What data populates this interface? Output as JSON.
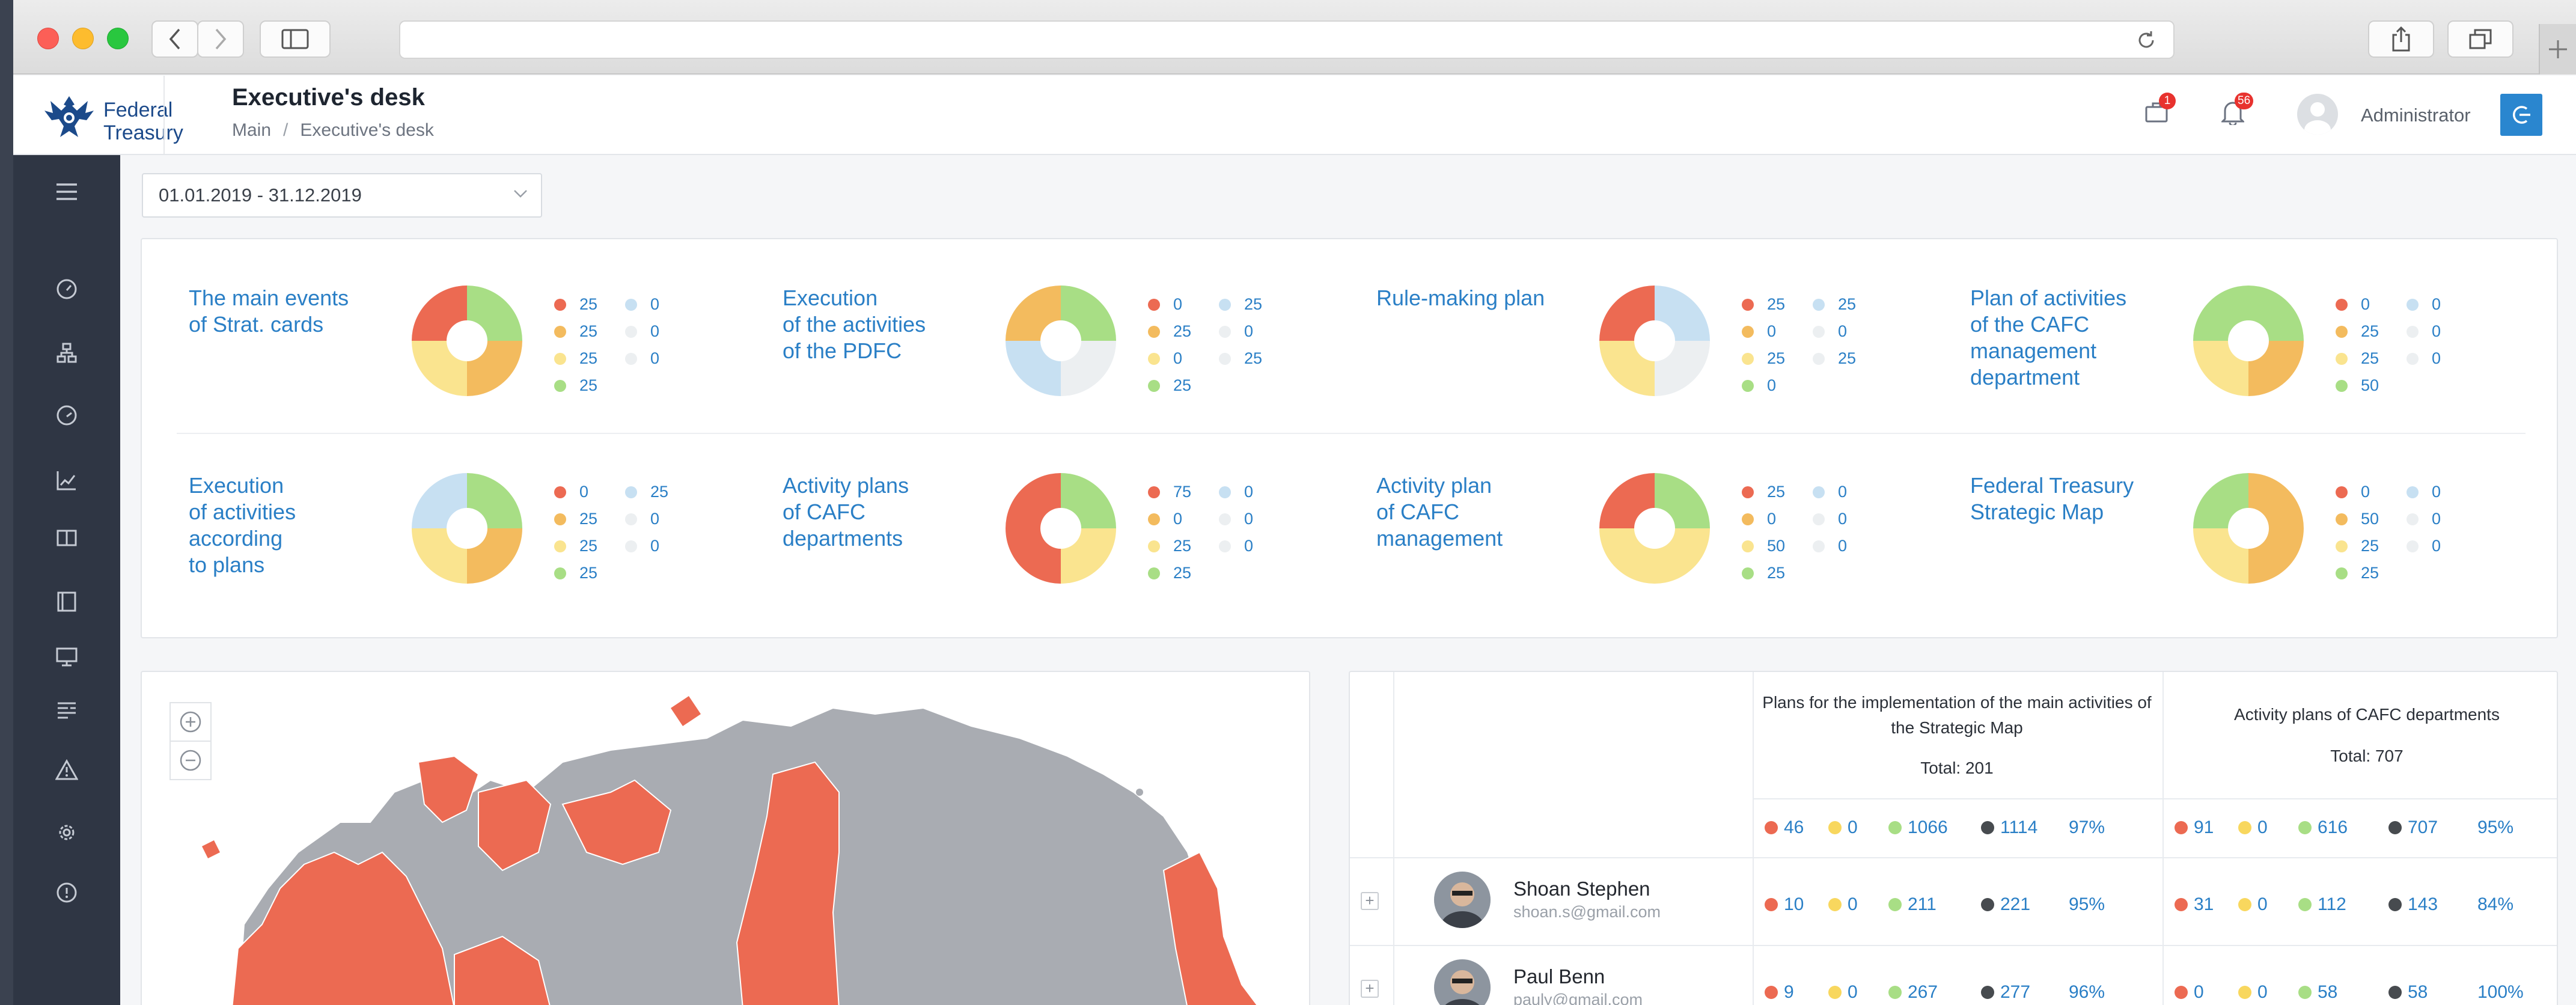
{
  "colors": {
    "red": "#ec6a52",
    "orange": "#f3bb5e",
    "yellow": "#fae48f",
    "green": "#a8de85",
    "blue": "#c7e0f2",
    "gray": "#eceff1",
    "dark": "#474b4f",
    "accent": "#2a7fc6"
  },
  "browser": {
    "nav_back_icon": "chevron-left-icon",
    "nav_forward_icon": "chevron-right-icon"
  },
  "header": {
    "logo_text": "Federal\nTreasury",
    "title": "Executive's desk",
    "breadcrumb": [
      "Main",
      "Executive's desk"
    ],
    "tasks_badge": "1",
    "notifications_badge": "56",
    "user_name": "Administrator"
  },
  "filter": {
    "date_range": "01.01.2019 - 31.12.2019"
  },
  "cards": [
    {
      "title": "The main events\nof Strat. cards",
      "values": {
        "red": "25",
        "orange": "25",
        "yellow": "25",
        "green": "25",
        "blue": "0",
        "gray1": "0",
        "gray2": "0"
      },
      "segments": [
        {
          "c": "green",
          "v": 25
        },
        {
          "c": "orange",
          "v": 25
        },
        {
          "c": "yellow",
          "v": 25
        },
        {
          "c": "red",
          "v": 25
        }
      ]
    },
    {
      "title": "Execution\nof the activities\nof the PDFC",
      "values": {
        "red": "0",
        "orange": "25",
        "yellow": "0",
        "green": "25",
        "blue": "25",
        "gray1": "0",
        "gray2": "25"
      },
      "segments": [
        {
          "c": "green",
          "v": 25
        },
        {
          "c": "gray",
          "v": 25
        },
        {
          "c": "blue",
          "v": 25
        },
        {
          "c": "orange",
          "v": 25
        }
      ]
    },
    {
      "title": "Rule-making plan",
      "values": {
        "red": "25",
        "orange": "0",
        "yellow": "25",
        "green": "0",
        "blue": "25",
        "gray1": "0",
        "gray2": "25"
      },
      "segments": [
        {
          "c": "blue",
          "v": 25
        },
        {
          "c": "gray",
          "v": 25
        },
        {
          "c": "yellow",
          "v": 25
        },
        {
          "c": "red",
          "v": 25
        }
      ]
    },
    {
      "title": "Plan of activities\nof the CAFC\nmanagement\ndepartment",
      "values": {
        "red": "0",
        "orange": "25",
        "yellow": "25",
        "green": "50",
        "blue": "0",
        "gray1": "0",
        "gray2": "0"
      },
      "segments": [
        {
          "c": "green",
          "v": 25
        },
        {
          "c": "orange",
          "v": 25
        },
        {
          "c": "yellow",
          "v": 25
        },
        {
          "c": "green",
          "v": 25
        }
      ]
    },
    {
      "title": "Execution\nof activities\naccording\nto plans",
      "values": {
        "red": "0",
        "orange": "25",
        "yellow": "25",
        "green": "25",
        "blue": "25",
        "gray1": "0",
        "gray2": "0"
      },
      "segments": [
        {
          "c": "green",
          "v": 25
        },
        {
          "c": "orange",
          "v": 25
        },
        {
          "c": "yellow",
          "v": 25
        },
        {
          "c": "blue",
          "v": 25
        }
      ]
    },
    {
      "title": "Activity plans\nof CAFC\ndepartments",
      "values": {
        "red": "75",
        "orange": "0",
        "yellow": "25",
        "green": "25",
        "blue": "0",
        "gray1": "0",
        "gray2": "0"
      },
      "segments": [
        {
          "c": "green",
          "v": 25
        },
        {
          "c": "yellow",
          "v": 25
        },
        {
          "c": "red",
          "v": 50
        }
      ]
    },
    {
      "title": "Activity plan\nof CAFC\nmanagement",
      "values": {
        "red": "25",
        "orange": "0",
        "yellow": "50",
        "green": "25",
        "blue": "0",
        "gray1": "0",
        "gray2": "0"
      },
      "segments": [
        {
          "c": "green",
          "v": 25
        },
        {
          "c": "yellow",
          "v": 50
        },
        {
          "c": "red",
          "v": 25
        }
      ]
    },
    {
      "title": "Federal Treasury\nStrategic Map",
      "values": {
        "red": "0",
        "orange": "50",
        "yellow": "25",
        "green": "25",
        "blue": "0",
        "gray1": "0",
        "gray2": "0"
      },
      "segments": [
        {
          "c": "orange",
          "v": 50
        },
        {
          "c": "yellow",
          "v": 25
        },
        {
          "c": "green",
          "v": 25
        }
      ]
    }
  ],
  "table": {
    "groups": [
      {
        "title": "Plans for the implementation of the main activities of the Strategic Map",
        "total": "Total: 201",
        "summary": {
          "red": "46",
          "yellow": "0",
          "green": "1066",
          "dark": "1114",
          "pct": "97%"
        }
      },
      {
        "title": "Activity plans of CAFC departments",
        "total": "Total: 707",
        "summary": {
          "red": "91",
          "yellow": "0",
          "green": "616",
          "dark": "707",
          "pct": "95%"
        }
      }
    ],
    "rows": [
      {
        "name": "Shoan Stephen",
        "email": "shoan.s@gmail.com",
        "g1": {
          "red": "10",
          "yellow": "0",
          "green": "211",
          "dark": "221",
          "pct": "95%"
        },
        "g2": {
          "red": "31",
          "yellow": "0",
          "green": "112",
          "dark": "143",
          "pct": "84%"
        }
      },
      {
        "name": "Paul Benn",
        "email": "pauly@gmail.com",
        "g1": {
          "red": "9",
          "yellow": "0",
          "green": "267",
          "dark": "277",
          "pct": "96%"
        },
        "g2": {
          "red": "0",
          "yellow": "0",
          "green": "58",
          "dark": "58",
          "pct": "100%"
        }
      }
    ]
  }
}
